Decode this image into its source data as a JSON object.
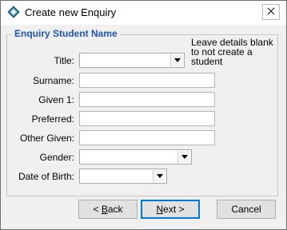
{
  "window": {
    "title": "Create new Enquiry",
    "app_icon": "diamond-app-icon",
    "close_icon": "close-icon"
  },
  "group": {
    "title": "Enquiry Student Name",
    "note": "Leave details blank to not create a student"
  },
  "fields": {
    "title_label": "Title:",
    "title_value": "",
    "surname_label": "Surname:",
    "surname_value": "",
    "given1_label": "Given 1:",
    "given1_value": "",
    "preferred_label": "Preferred:",
    "preferred_value": "",
    "other_given_label": "Other Given:",
    "other_given_value": "",
    "gender_label": "Gender:",
    "gender_value": "",
    "dob_label": "Date of Birth:",
    "dob_value": ""
  },
  "buttons": {
    "back_prefix": "< ",
    "back_mnemonic": "B",
    "back_rest": "ack",
    "next_mnemonic": "N",
    "next_rest": "ext >",
    "cancel": "Cancel"
  },
  "colors": {
    "group_title": "#1c55b4",
    "default_button_border": "#0078d7"
  }
}
